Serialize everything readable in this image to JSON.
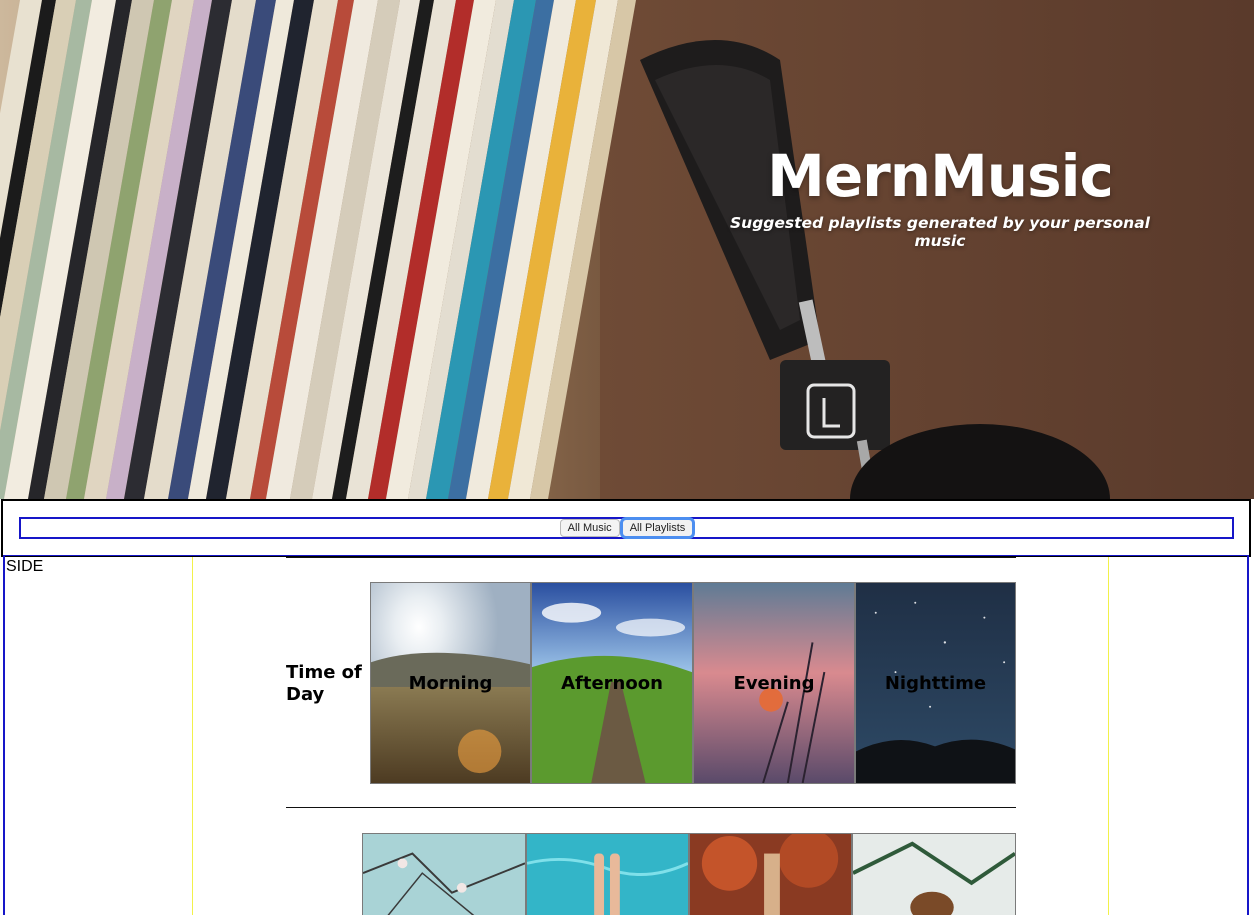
{
  "hero": {
    "title": "MernMusic",
    "subtitle": "Suggested playlists generated by your personal music"
  },
  "nav": {
    "buttons": [
      {
        "label": "All Music",
        "active": false
      },
      {
        "label": "All Playlists",
        "active": true
      }
    ]
  },
  "sidebar": {
    "label": "SIDE"
  },
  "sections": [
    {
      "title": "Time of Day",
      "tiles": [
        {
          "label": "Morning",
          "icon": "morning-sunrise-image"
        },
        {
          "label": "Afternoon",
          "icon": "afternoon-meadow-image"
        },
        {
          "label": "Evening",
          "icon": "evening-sunset-image"
        },
        {
          "label": "Nighttime",
          "icon": "nighttime-stars-image"
        }
      ]
    },
    {
      "title": "",
      "tiles": [
        {
          "label": "",
          "icon": "spring-blossom-image"
        },
        {
          "label": "",
          "icon": "summer-pool-image"
        },
        {
          "label": "",
          "icon": "autumn-forest-image"
        },
        {
          "label": "",
          "icon": "winter-pinecone-image"
        }
      ]
    }
  ],
  "colors": {
    "frame_blue": "#1616c8",
    "guide_yellow": "#f2f14a",
    "active_focus": "#4c8ef0"
  }
}
